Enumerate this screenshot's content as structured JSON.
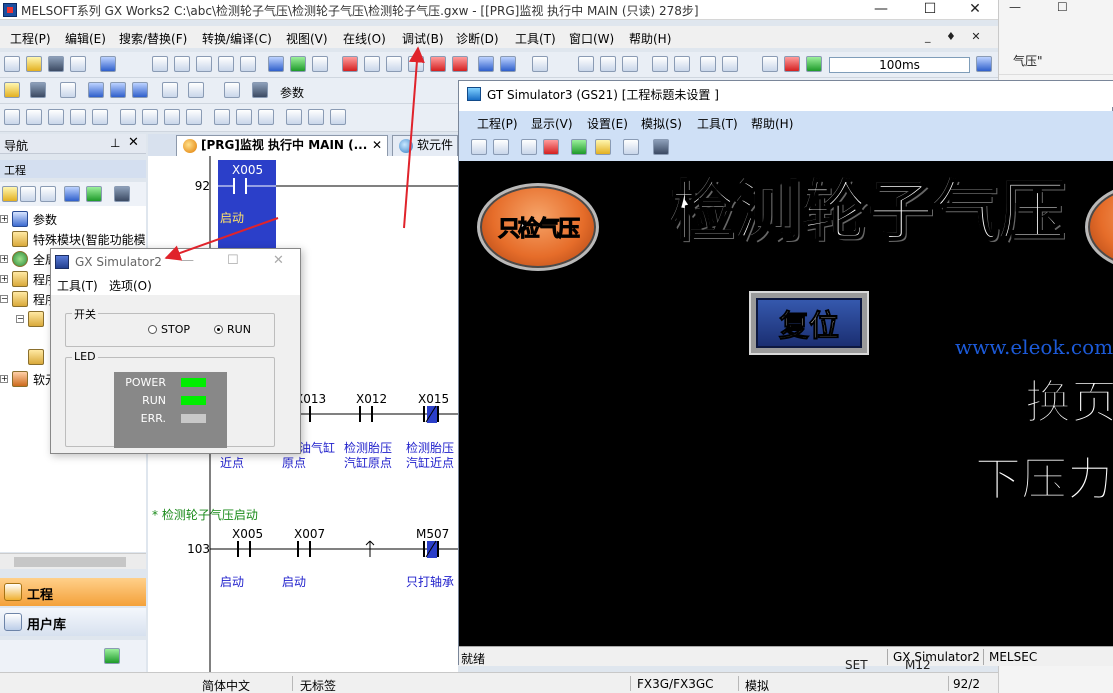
{
  "main_window": {
    "title": "MELSOFT系列 GX Works2 C:\\abc\\检测轮子气压\\检测轮子气压\\检测轮子气压.gxw - [[PRG]监视 执行中 MAIN (只读) 278步]",
    "controls": {
      "minimize": "—",
      "maximize": "☐",
      "close": "✕"
    },
    "menu": [
      "工程(P)",
      "编辑(E)",
      "搜索/替换(F)",
      "转换/编译(C)",
      "视图(V)",
      "在线(O)",
      "调试(B)",
      "诊断(D)",
      "工具(T)",
      "窗口(W)",
      "帮助(H)"
    ],
    "menu_window_controls": "_ ♦ ✕",
    "scan_time": "100ms",
    "param_label": "参数"
  },
  "background_window": {
    "side_text": "气压\"",
    "controls": {
      "minimize": "—",
      "maximize": "☐"
    }
  },
  "navigator": {
    "header": "导航",
    "pin": "⊥",
    "close": "✕",
    "section_label": "工程",
    "tree": [
      "参数",
      "特殊模块(智能功能模",
      "全局",
      "程序",
      "程序",
      "",
      "",
      "软元"
    ],
    "tabs": {
      "project": "工程",
      "library": "用户库"
    }
  },
  "editor": {
    "tabs": [
      {
        "label": "[PRG]监视 执行中 MAIN (...",
        "close": "✕"
      },
      {
        "label": "软元件"
      }
    ],
    "steps": [
      "92",
      "103"
    ],
    "devices_row1": [
      "X005"
    ],
    "labels_row1": [
      "启动"
    ],
    "devices_row2": [
      "X013",
      "X012",
      "X015"
    ],
    "labels_row2": [
      "近点",
      "油气缸",
      "原点",
      "检测胎压",
      "汽缸原点",
      "检测胎压",
      "汽缸近点"
    ],
    "comment": "* 检测轮子气压启动",
    "devices_row3": [
      "X005",
      "X007",
      "M507"
    ],
    "labels_row3": [
      "启动",
      "启动",
      "只打轴承"
    ],
    "bottom_cut": [
      "SET",
      "M12"
    ]
  },
  "gx_simulator2": {
    "title": "GX Simulator2",
    "menu": [
      "工具(T)",
      "选项(O)"
    ],
    "switch_group": "开关",
    "stop_label": "STOP",
    "run_label": "RUN",
    "selected": "RUN",
    "led_group": "LED",
    "leds": [
      {
        "name": "POWER",
        "color": "#00ee00"
      },
      {
        "name": "RUN",
        "color": "#00ee00"
      },
      {
        "name": "ERR.",
        "color": "#c8c8c8"
      }
    ]
  },
  "gt_simulator3": {
    "title": "GT Simulator3 (GS21)  [工程标题未设置 ]",
    "menu": [
      "工程(P)",
      "显示(V)",
      "设置(E)",
      "模拟(S)",
      "工具(T)",
      "帮助(H)"
    ],
    "hmi": {
      "title": "检测轮子气压",
      "left_button": "只检气压",
      "reset_button": "复位",
      "watermark": "www.eleok.com",
      "swap_page": "换页",
      "down_pressure": "下压力:"
    },
    "status": [
      "就绪",
      "GX Simulator2",
      "MELSEC"
    ]
  },
  "main_status": [
    "简体中文",
    "无标签",
    "FX3G/FX3GC",
    "模拟",
    "92/2"
  ],
  "colors": {
    "ladder_highlight": "#2b3fc9",
    "hmi_orange": "#e66d2a",
    "reset_blue": "#1b2f72",
    "led_green": "#00ee00",
    "arrow_red": "#e0232b"
  }
}
